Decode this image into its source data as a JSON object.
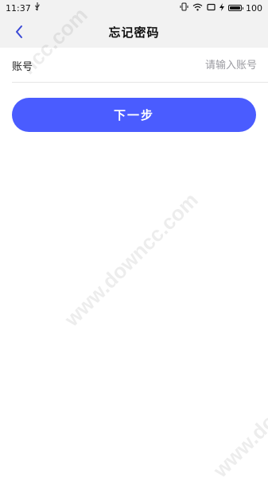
{
  "status_bar": {
    "time": "11:37",
    "battery": "100",
    "icons": [
      "usb-icon",
      "vibrate-icon",
      "wifi-icon",
      "screen-icon",
      "charging-icon",
      "battery-icon"
    ]
  },
  "nav": {
    "title": "忘记密码",
    "back_icon": "chevron-left-icon"
  },
  "form": {
    "account_label": "账号",
    "account_placeholder": "请输入账号",
    "account_value": ""
  },
  "actions": {
    "next_label": "下一步"
  },
  "colors": {
    "primary": "#4a5cff",
    "header_bg": "#f2f2f2",
    "back_icon": "#3b49d6",
    "placeholder": "#9a9aa0"
  },
  "watermark": {
    "text1": "ncc.com",
    "text2": "www.downcc.com",
    "text3": "www.dow"
  }
}
